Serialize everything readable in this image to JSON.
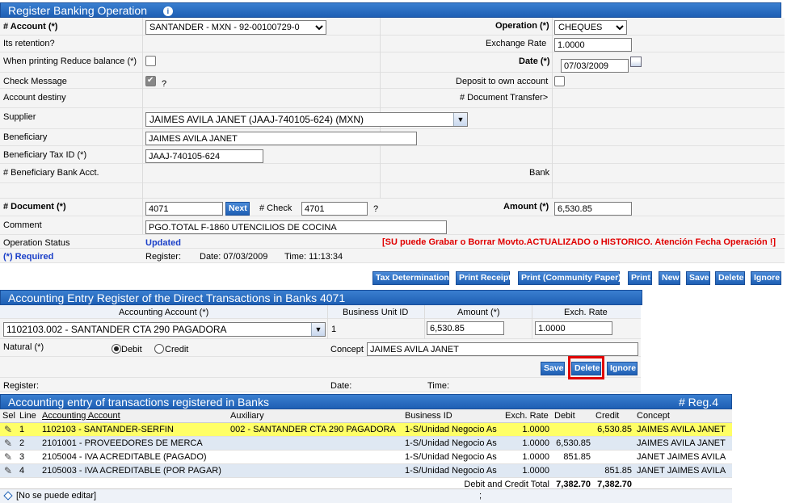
{
  "banking": {
    "title": "Register Banking Operation",
    "account_label": "# Account (*)",
    "account_value": "SANTANDER - MXN - 92-00100729-0",
    "operation_label": "Operation (*)",
    "operation_value": "CHEQUES",
    "retention_label": "Its retention?",
    "exchange_rate_label": "Exchange Rate",
    "exchange_rate_value": "1.0000",
    "reduce_balance_label": "When printing Reduce balance (*)",
    "date_label": "Date (*)",
    "date_value": "07/03/2009",
    "check_message_label": "Check Message",
    "question_mark": "?",
    "deposit_own_label": "Deposit to own account",
    "account_destiny_label": "Account destiny",
    "doc_transfer_label": "# Document Transfer>",
    "supplier_label": "Supplier",
    "supplier_value": "JAIMES AVILA JANET (JAAJ-740105-624) (MXN)",
    "beneficiary_label": "Beneficiary",
    "beneficiary_value": "JAIMES AVILA JANET",
    "tax_id_label": "Beneficiary Tax ID (*)",
    "tax_id_value": "JAAJ-740105-624",
    "bank_acct_label": "# Beneficiary Bank Acct.",
    "bank_label": "Bank",
    "document_label": "# Document (*)",
    "document_value": "4071",
    "next_label": "Next",
    "check_label": "# Check",
    "check_value": "4701",
    "amount_label": "Amount (*)",
    "amount_value": "6,530.85",
    "comment_label": "Comment",
    "comment_value": "PGO.TOTAL F-1860 UTENCILIOS DE COCINA",
    "status_label": "Operation Status",
    "status_value": "Updated",
    "warning": "[SU puede Grabar o Borrar Movto.ACTUALIZADO o HISTORICO. Atención Fecha Operación !]",
    "required_label": "(*) Required",
    "register_label": "Register:",
    "register_date": "Date: 07/03/2009",
    "register_time": "Time: 11:13:34",
    "buttons": [
      "Tax Determination",
      "Print Receipt",
      "Print (Community Paper)",
      "Print",
      "New",
      "Save",
      "Delete",
      "Ignore"
    ]
  },
  "entry": {
    "title": "Accounting Entry Register of the Direct Transactions in Banks 4071",
    "col_account": "Accounting Account (*)",
    "col_bu": "Business Unit ID",
    "col_amount": "Amount (*)",
    "col_rate": "Exch. Rate",
    "account_value": "1102103.002 - SANTANDER CTA 290 PAGADORA",
    "bu_value": "1",
    "amount_value": "6,530.85",
    "rate_value": "1.0000",
    "natural_label": "Natural (*)",
    "debit_label": "Debit",
    "credit_label": "Credit",
    "concept_label": "Concept",
    "concept_value": "JAIMES AVILA JANET",
    "save": "Save",
    "delete": "Delete",
    "ignore": "Ignore",
    "register_label": "Register:",
    "date_label": "Date:",
    "time_label": "Time:"
  },
  "list": {
    "title": "Accounting entry of transactions registered in Banks",
    "count": "# Reg.4",
    "headers": [
      "Sel",
      "Line",
      "Accounting Account",
      "Auxiliary",
      "Business ID",
      "Exch. Rate",
      "Debit",
      "Credit",
      "Concept"
    ],
    "rows": [
      {
        "line": "1",
        "account": "1102103 - SANTANDER-SERFIN",
        "aux": "002 - SANTANDER CTA 290 PAGADORA",
        "bid": "1-S/Unidad Negocio As",
        "rate": "1.0000",
        "debit": "",
        "credit": "6,530.85",
        "concept": "JAIMES AVILA JANET"
      },
      {
        "line": "2",
        "account": "2101001 - PROVEEDORES DE MERCA",
        "aux": "",
        "bid": "1-S/Unidad Negocio As",
        "rate": "1.0000",
        "debit": "6,530.85",
        "credit": "",
        "concept": "JAIMES AVILA JANET"
      },
      {
        "line": "3",
        "account": "2105004 - IVA ACREDITABLE (PAGADO)",
        "aux": "",
        "bid": "1-S/Unidad Negocio As",
        "rate": "1.0000",
        "debit": "851.85",
        "credit": "",
        "concept": "JANET JAIMES AVILA"
      },
      {
        "line": "4",
        "account": "2105003 - IVA ACREDITABLE (POR PAGAR)",
        "aux": "",
        "bid": "1-S/Unidad Negocio As",
        "rate": "1.0000",
        "debit": "",
        "credit": "851.85",
        "concept": "JANET JAIMES AVILA"
      }
    ],
    "total_label": "Debit and Credit Total",
    "total_debit": "7,382.70",
    "total_credit": "7,382.70",
    "footer_note": "[No se puede editar]",
    "footer_semicolon": ";"
  },
  "colors": {
    "header_blue": "#1e5fb4",
    "highlight_row": "#ffff66",
    "alt_row": "#dfe8f3",
    "warning_red": "#e00000",
    "link_blue": "#1a3fc8",
    "focus_border": "#e00000"
  }
}
